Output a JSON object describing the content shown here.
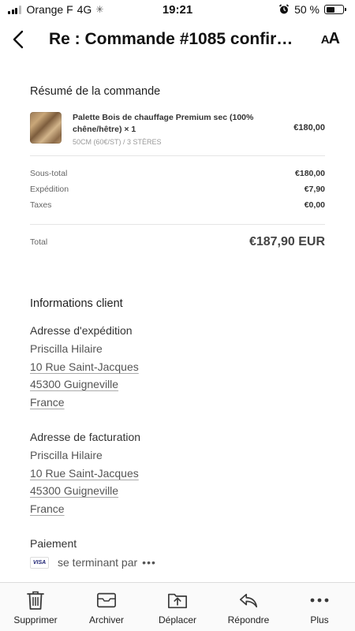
{
  "status_bar": {
    "carrier": "Orange F",
    "network": "4G",
    "time": "19:21",
    "battery_percent": "50 %",
    "battery_level": 0.5
  },
  "header": {
    "title": "Re : Commande #1085 confirmée",
    "text_size_label_small": "A",
    "text_size_label_large": "A"
  },
  "order_summary": {
    "title": "Résumé de la commande",
    "item": {
      "name": "Palette Bois de chauffage Premium sec (100% chêne/hêtre) × 1",
      "variant": "50CM (60€/ST) / 3 STÈRES",
      "price": "€180,00"
    },
    "subtotal_label": "Sous-total",
    "subtotal_value": "€180,00",
    "shipping_label": "Expédition",
    "shipping_value": "€7,90",
    "taxes_label": "Taxes",
    "taxes_value": "€0,00",
    "total_label": "Total",
    "total_value": "€187,90 EUR"
  },
  "customer_info": {
    "title": "Informations client",
    "shipping_address": {
      "title": "Adresse d'expédition",
      "lines": [
        "Priscilla Hilaire",
        "10 Rue Saint-Jacques",
        "45300 Guigneville",
        "France"
      ]
    },
    "billing_address": {
      "title": "Adresse de facturation",
      "lines": [
        "Priscilla Hilaire",
        "10 Rue Saint-Jacques",
        "45300 Guigneville",
        "France"
      ]
    },
    "payment": {
      "title": "Paiement",
      "card_brand": "VISA",
      "text": "se terminant par",
      "more": "•••"
    }
  },
  "toolbar": {
    "items": [
      {
        "label": "Supprimer",
        "icon": "trash-icon"
      },
      {
        "label": "Archiver",
        "icon": "archive-icon"
      },
      {
        "label": "Déplacer",
        "icon": "move-folder-icon"
      },
      {
        "label": "Répondre",
        "icon": "reply-icon"
      },
      {
        "label": "Plus",
        "icon": "more-icon"
      }
    ]
  }
}
